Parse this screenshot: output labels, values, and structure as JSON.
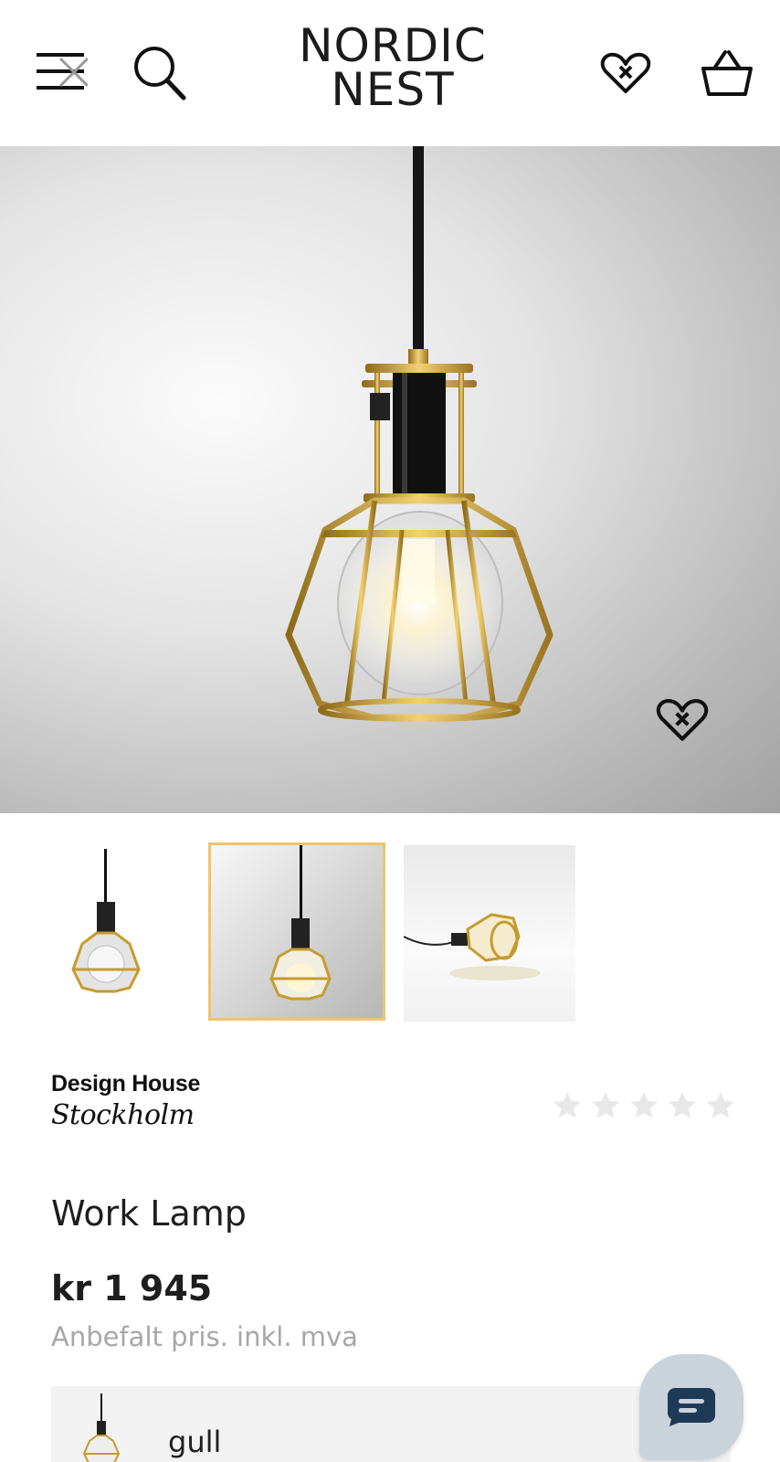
{
  "header": {
    "logo_line1": "NORDIC",
    "logo_line2": "NEST",
    "icons": [
      "menu-close-icon",
      "search-icon",
      "heart-wishlist-icon",
      "shopping-basket-icon"
    ]
  },
  "product": {
    "brand_line1": "Design House",
    "brand_line2": "Stockholm",
    "rating": {
      "value": 0,
      "max": 5
    },
    "title": "Work Lamp",
    "price": "kr 1 945",
    "price_note": "Anbefalt pris. inkl. mva",
    "variant_label": "gull",
    "thumbnails_count": 3,
    "selected_thumbnail": 2
  },
  "colors": {
    "accent_border": "#f1c36b",
    "gold": "#c9a33a",
    "chat_bg": "#c9d3d9",
    "chat_icon": "#1f3a57",
    "muted_text": "#a7a7a7"
  }
}
